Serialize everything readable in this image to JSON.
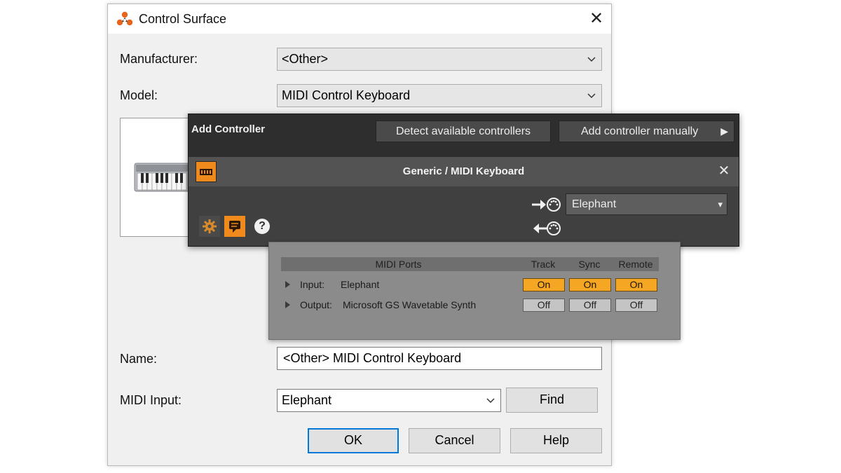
{
  "dialog": {
    "title": "Control Surface",
    "close_glyph": "✕",
    "manufacturer_label": "Manufacturer:",
    "manufacturer_value": "<Other>",
    "model_label": "Model:",
    "model_value": "MIDI Control Keyboard",
    "name_label": "Name:",
    "name_value": "<Other> MIDI Control Keyboard",
    "midi_input_label": "MIDI Input:",
    "midi_input_value": "Elephant",
    "find_label": "Find",
    "ok_label": "OK",
    "cancel_label": "Cancel",
    "help_label": "Help"
  },
  "add_controller": {
    "title": "Add Controller",
    "detect_label": "Detect available controllers",
    "manual_label": "Add controller manually",
    "manual_arrow": "▶",
    "controller_name": "Generic / MIDI Keyboard",
    "close_glyph": "✕",
    "input_port_value": "Elephant",
    "dropdown_arrow": "▾",
    "help_glyph": "?"
  },
  "midi_ports": {
    "headers": {
      "ports": "MIDI Ports",
      "track": "Track",
      "sync": "Sync",
      "remote": "Remote"
    },
    "rows": [
      {
        "direction": "Input:",
        "device": "Elephant",
        "track": "On",
        "sync": "On",
        "remote": "On"
      },
      {
        "direction": "Output:",
        "device": "Microsoft GS Wavetable Synth",
        "track": "Off",
        "sync": "Off",
        "remote": "Off"
      }
    ]
  },
  "colors": {
    "accent_orange": "#f5a623",
    "dark_panel": "#2e2e2e",
    "focus_blue": "#0078d7"
  },
  "icons": [
    "reason-logo-icon",
    "close-icon",
    "chevron-down-icon",
    "keyboard-image",
    "midi-keyboard-icon",
    "gear-icon",
    "chat-icon",
    "help-icon",
    "midi-in-icon",
    "midi-out-icon",
    "expand-triangle-icon",
    "play-arrow-icon"
  ]
}
